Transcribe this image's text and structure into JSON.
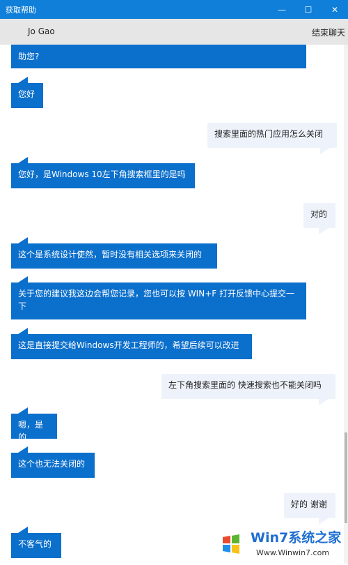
{
  "window": {
    "title": "获取帮助",
    "controls": {
      "minimize": "—",
      "maximize": "☐",
      "close": "✕"
    }
  },
  "header": {
    "agent_name": "Jo Gao",
    "end_chat": "结束聊天"
  },
  "messages": [
    {
      "from": "agent",
      "text": "助您?"
    },
    {
      "from": "agent",
      "text": "您好"
    },
    {
      "from": "user",
      "text": "搜索里面的热门应用怎么关闭"
    },
    {
      "from": "agent",
      "text": "您好，是Windows 10左下角搜索框里的是吗"
    },
    {
      "from": "user",
      "text": "对的"
    },
    {
      "from": "agent",
      "text": "这个是系统设计使然，暂时没有相关选项来关闭的"
    },
    {
      "from": "agent",
      "text": "关于您的建议我这边会帮您记录，您也可以按 WIN+F 打开反馈中心提交一下"
    },
    {
      "from": "agent",
      "text": "这是直接提交给Windows开发工程师的，希望后续可以改进"
    },
    {
      "from": "user",
      "text": "左下角搜索里面的 快速搜索也不能关闭吗"
    },
    {
      "from": "agent",
      "text": "嗯，是的"
    },
    {
      "from": "agent",
      "text": "这个也无法关闭的"
    },
    {
      "from": "user",
      "text": "好的 谢谢"
    },
    {
      "from": "agent",
      "text": "不客气的"
    }
  ],
  "watermark": {
    "brand": "Win7系统之家",
    "url": "Www.Winwin7.com"
  },
  "colors": {
    "titlebar": "#0f7fd9",
    "agent_bubble": "#0b6fcc",
    "user_bubble": "#eef3fb"
  }
}
